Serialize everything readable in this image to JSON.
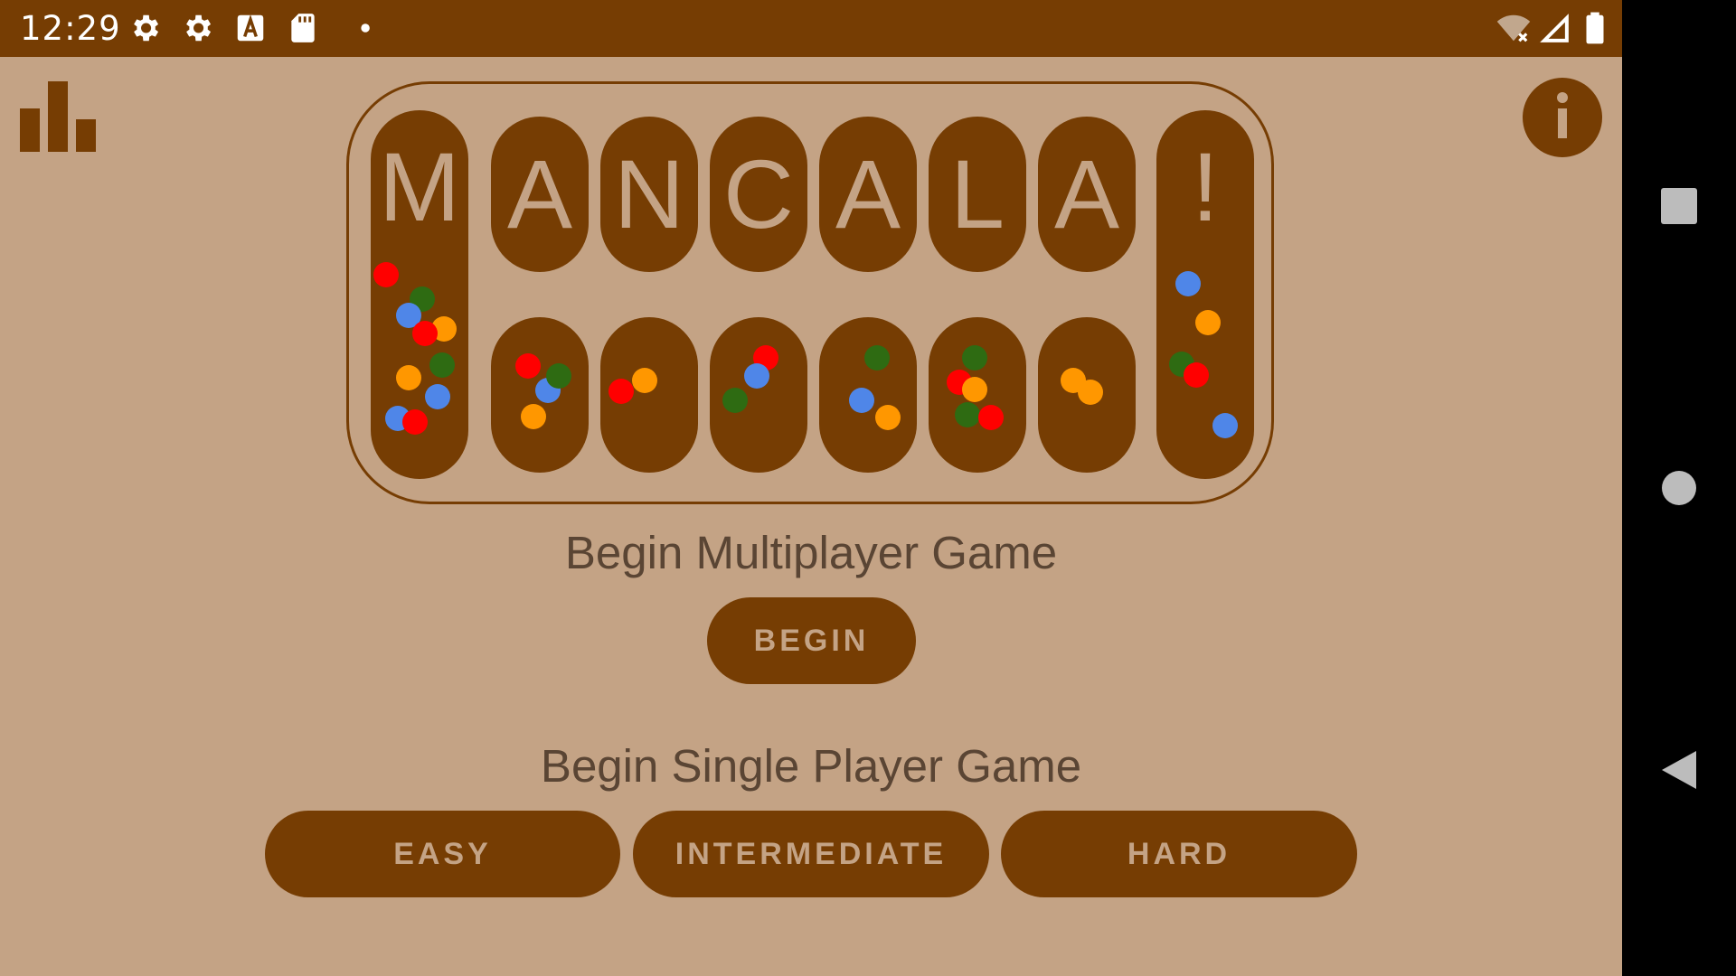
{
  "status_bar": {
    "time": "12:29",
    "left_icons": [
      "gear-icon",
      "gear-icon",
      "text-a-icon",
      "sd-card-icon",
      "notification-dot-icon"
    ],
    "right_icons": [
      "wifi-off-icon",
      "cell-signal-icon",
      "battery-icon"
    ]
  },
  "board": {
    "title_letters": [
      "M",
      "A",
      "N",
      "C",
      "A",
      "L",
      "A",
      "!"
    ]
  },
  "multiplayer": {
    "heading": "Begin Multiplayer Game",
    "button_label": "BEGIN"
  },
  "single_player": {
    "heading": "Begin Single Player Game",
    "easy_label": "EASY",
    "intermediate_label": "INTERMEDIATE",
    "hard_label": "HARD"
  },
  "colors": {
    "background": "#c4a385",
    "brown": "#763d03",
    "stone_red": "#ff0000",
    "stone_green": "#2e6b12",
    "stone_blue": "#4f86e8",
    "stone_orange": "#ff9700"
  },
  "icons": {
    "stats": "bar-chart-icon",
    "info": "info-icon",
    "nav_overview": "square-icon",
    "nav_home": "circle-icon",
    "nav_back": "back-triangle-icon"
  }
}
